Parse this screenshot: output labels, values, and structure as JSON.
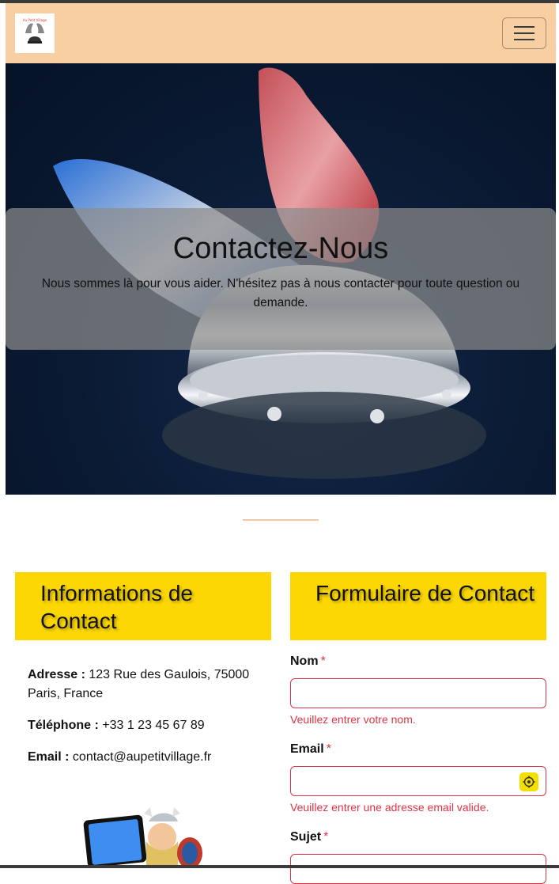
{
  "navbar": {
    "logo_text": "Au Petit Village",
    "toggler_label": "Toggle navigation"
  },
  "hero": {
    "title": "Contactez-Nous",
    "subtitle": "Nous sommes là pour vous aider. N'hésitez pas à nous contacter pour toute question ou demande."
  },
  "info": {
    "heading": "Informations de Contact",
    "address_label": "Adresse :",
    "address_value": "123 Rue des Gaulois, 75000 Paris, France",
    "phone_label": "Téléphone :",
    "phone_value": "+33 1 23 45 67 89",
    "email_label": "Email :",
    "email_value": "contact@aupetitvillage.fr"
  },
  "form": {
    "heading": "Formulaire de Contact",
    "required_mark": "*",
    "nom_label": "Nom",
    "nom_value": "",
    "nom_error": "Veuillez entrer votre nom.",
    "email_label": "Email",
    "email_value": "",
    "email_error": "Veuillez entrer une adresse email valide.",
    "sujet_label": "Sujet",
    "sujet_value": ""
  },
  "colors": {
    "navbar_bg": "#f8cfa3",
    "heading_bg": "#fcd704",
    "error": "#dc3545"
  }
}
